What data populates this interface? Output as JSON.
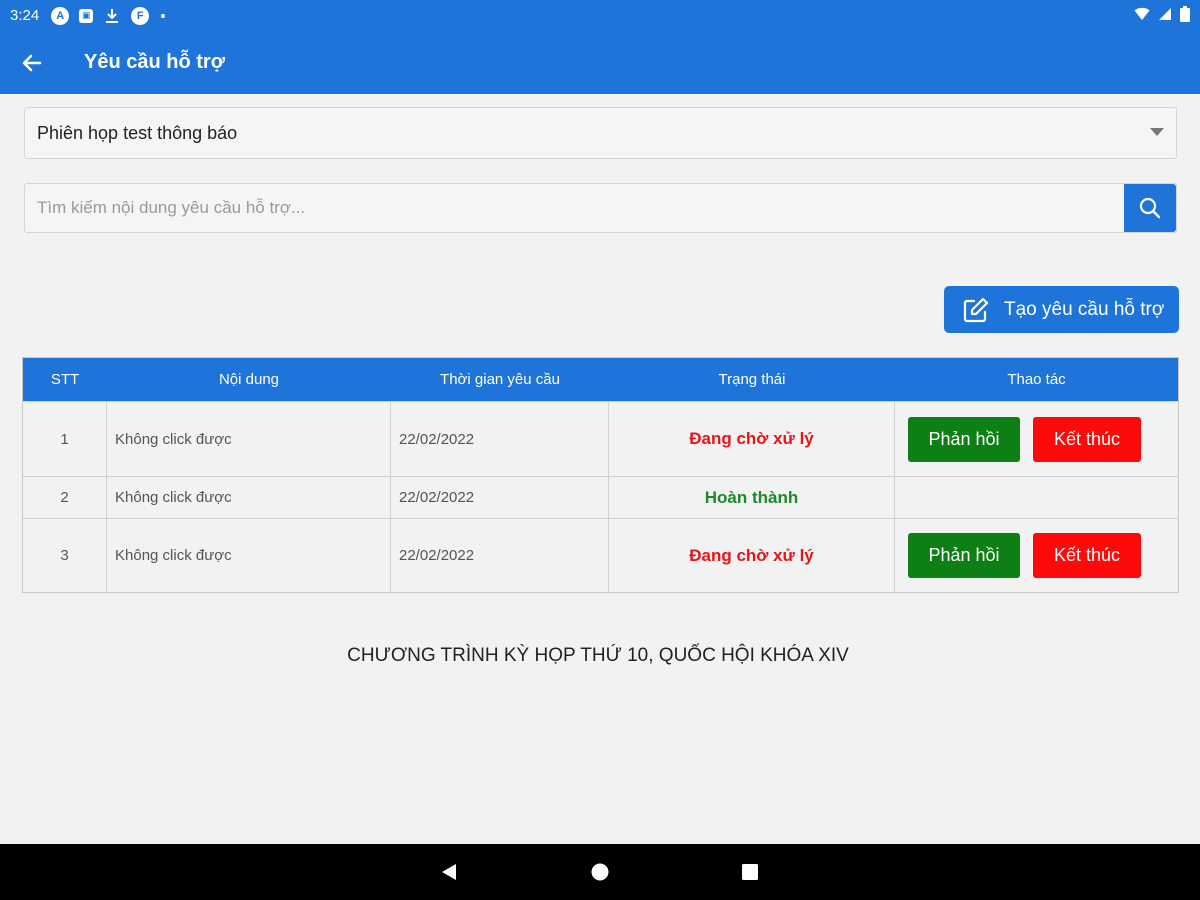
{
  "status_bar": {
    "time": "3:24"
  },
  "app_bar": {
    "title": "Yêu cầu hỗ trợ"
  },
  "session_select": {
    "selected": "Phiên họp test thông báo"
  },
  "search": {
    "placeholder": "Tìm kiếm nội dung yêu cầu hỗ trợ..."
  },
  "create_button": {
    "label": "Tạo yêu cầu hỗ trợ"
  },
  "table": {
    "headers": {
      "stt": "STT",
      "content": "Nội dung",
      "time": "Thời gian yêu cầu",
      "status": "Trạng thái",
      "actions": "Thao tác"
    },
    "rows": [
      {
        "stt": "1",
        "content": "Không click được",
        "time": "22/02/2022",
        "status": "Đang chờ xử lý",
        "reply_label": "Phản hồi",
        "end_label": "Kết thúc"
      },
      {
        "stt": "2",
        "content": "Không click được",
        "time": "22/02/2022",
        "status": "Hoàn thành"
      },
      {
        "stt": "3",
        "content": "Không click được",
        "time": "22/02/2022",
        "status": "Đang chờ xử lý",
        "reply_label": "Phản hồi",
        "end_label": "Kết thúc"
      }
    ]
  },
  "footer": {
    "text": "CHƯƠNG TRÌNH KỲ HỌP THỨ 10, QUỐC HỘI KHÓA XIV"
  },
  "colors": {
    "primary": "#1e74d9",
    "pending": "#e8141a",
    "done": "#1c8a2a",
    "reply_button": "#0d7f14",
    "end_button": "#ff0a0a"
  }
}
